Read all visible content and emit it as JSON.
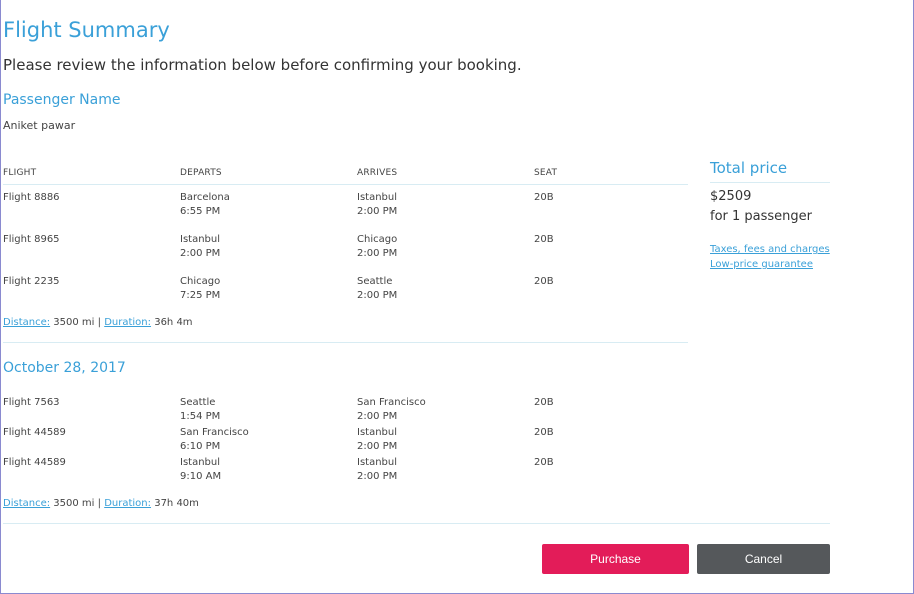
{
  "page": {
    "title": "Flight Summary",
    "subtitle": "Please review the information below before confirming your booking."
  },
  "passenger": {
    "heading": "Passenger Name",
    "name": "Aniket pawar"
  },
  "table": {
    "headers": [
      "FLIGHT",
      "DEPARTS",
      "ARRIVES",
      "SEAT"
    ]
  },
  "segment1": {
    "rows": [
      {
        "flight": "Flight 8886",
        "dep_city": "Barcelona",
        "dep_time": "6:55 PM",
        "arr_city": "Istanbul",
        "arr_time": "2:00 PM",
        "seat": "20B"
      },
      {
        "flight": "Flight 8965",
        "dep_city": "Istanbul",
        "dep_time": "2:00 PM",
        "arr_city": "Chicago",
        "arr_time": "2:00 PM",
        "seat": "20B"
      },
      {
        "flight": "Flight 2235",
        "dep_city": "Chicago",
        "dep_time": "7:25 PM",
        "arr_city": "Seattle",
        "arr_time": "2:00 PM",
        "seat": "20B"
      }
    ],
    "distance_label": "Distance:",
    "distance_value": "3500 mi",
    "separator": "|",
    "duration_label": "Duration:",
    "duration_value": "36h 4m"
  },
  "segment2": {
    "date": "October 28, 2017",
    "rows": [
      {
        "flight": "Flight 7563",
        "dep_city": "Seattle",
        "dep_time": "1:54 PM",
        "arr_city": "San Francisco",
        "arr_time": "2:00 PM",
        "seat": "20B"
      },
      {
        "flight": "Flight 44589",
        "dep_city": "San Francisco",
        "dep_time": "6:10 PM",
        "arr_city": "Istanbul",
        "arr_time": "2:00 PM",
        "seat": "20B"
      },
      {
        "flight": "Flight 44589",
        "dep_city": "Istanbul",
        "dep_time": "9:10 AM",
        "arr_city": "Istanbul",
        "arr_time": "2:00 PM",
        "seat": "20B"
      }
    ],
    "distance_label": "Distance:",
    "distance_value": "3500 mi",
    "separator": "|",
    "duration_label": "Duration:",
    "duration_value": "37h 40m"
  },
  "price": {
    "label": "Total price",
    "amount": "$2509",
    "per": "for 1 passenger",
    "links": [
      "Taxes, fees and charges",
      "Low-price guarantee"
    ]
  },
  "actions": {
    "purchase": "Purchase",
    "cancel": "Cancel"
  },
  "colors": {
    "accent": "#3aa0d8",
    "purchase": "#e31c59",
    "cancel": "#55585b"
  }
}
